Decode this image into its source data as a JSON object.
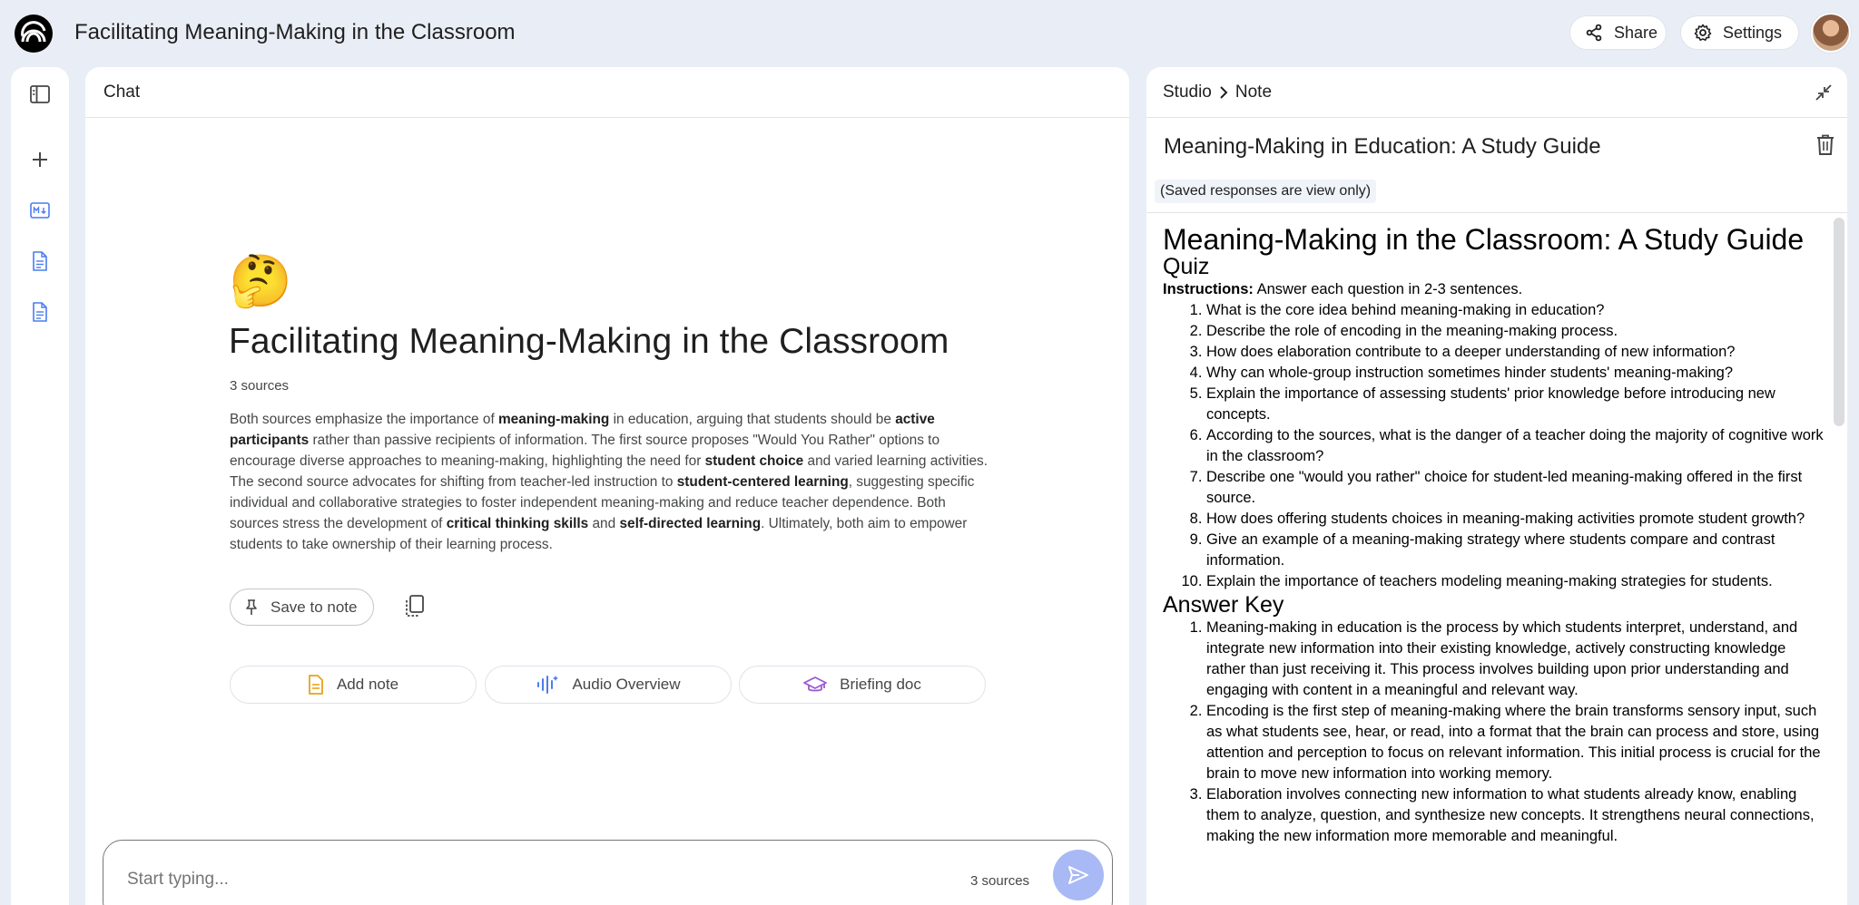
{
  "header": {
    "title": "Facilitating Meaning-Making in the Classroom",
    "share_label": "Share",
    "settings_label": "Settings"
  },
  "chat": {
    "panel_title": "Chat",
    "emoji": "🤔",
    "title": "Facilitating Meaning-Making in the Classroom",
    "sources_count": "3 sources",
    "summary": [
      {
        "t": "Both sources emphasize the importance of "
      },
      {
        "t": "meaning-making",
        "b": true
      },
      {
        "t": " in education, arguing that students should be "
      },
      {
        "t": "active participants",
        "b": true
      },
      {
        "t": " rather than passive recipients of information. The first source proposes \"Would You Rather\" options to encourage diverse approaches to meaning-making, highlighting the need for "
      },
      {
        "t": "student choice",
        "b": true
      },
      {
        "t": " and varied learning activities. The second source advocates for shifting from teacher-led instruction to "
      },
      {
        "t": "student-centered learning",
        "b": true
      },
      {
        "t": ", suggesting specific individual and collaborative strategies to foster independent meaning-making and reduce teacher dependence. Both sources stress the development of "
      },
      {
        "t": "critical thinking skills",
        "b": true
      },
      {
        "t": " and "
      },
      {
        "t": "self-directed learning",
        "b": true
      },
      {
        "t": ". Ultimately, both aim to empower students to take ownership of their learning process."
      }
    ],
    "save_to_note_label": "Save to note",
    "add_note_label": "Add note",
    "audio_overview_label": "Audio Overview",
    "briefing_doc_label": "Briefing doc",
    "input_placeholder": "Start typing...",
    "input_sources": "3 sources"
  },
  "studio": {
    "crumb_root": "Studio",
    "crumb_current": "Note",
    "note_title": "Meaning-Making in Education: A Study Guide",
    "view_only": "(Saved responses are view only)",
    "doc_title": "Meaning-Making in the Classroom: A Study Guide",
    "quiz_heading": "Quiz",
    "instructions_label": "Instructions:",
    "instructions_text": " Answer each question in 2-3 sentences.",
    "questions": [
      "What is the core idea behind meaning-making in education?",
      "Describe the role of encoding in the meaning-making process.",
      "How does elaboration contribute to a deeper understanding of new information?",
      "Why can whole-group instruction sometimes hinder students' meaning-making?",
      "Explain the importance of assessing students' prior knowledge before introducing new concepts.",
      "According to the sources, what is the danger of a teacher doing the majority of cognitive work in the classroom?",
      "Describe one \"would you rather\" choice for student-led meaning-making offered in the first source.",
      "How does offering students choices in meaning-making activities promote student growth?",
      "Give an example of a meaning-making strategy where students compare and contrast information.",
      "Explain the importance of teachers modeling meaning-making strategies for students."
    ],
    "answer_heading": "Answer Key",
    "answers": [
      "Meaning-making in education is the process by which students interpret, understand, and integrate new information into their existing knowledge, actively constructing knowledge rather than just receiving it. This process involves building upon prior understanding and engaging with content in a meaningful and relevant way.",
      "Encoding is the first step of meaning-making where the brain transforms sensory input, such as what students see, hear, or read, into a format that the brain can process and store, using attention and perception to focus on relevant information. This initial process is crucial for the brain to move new information into working memory.",
      "Elaboration involves connecting new information to what students already know, enabling them to analyze, question, and synthesize new concepts. It strengthens neural connections, making the new information more memorable and meaningful."
    ]
  }
}
